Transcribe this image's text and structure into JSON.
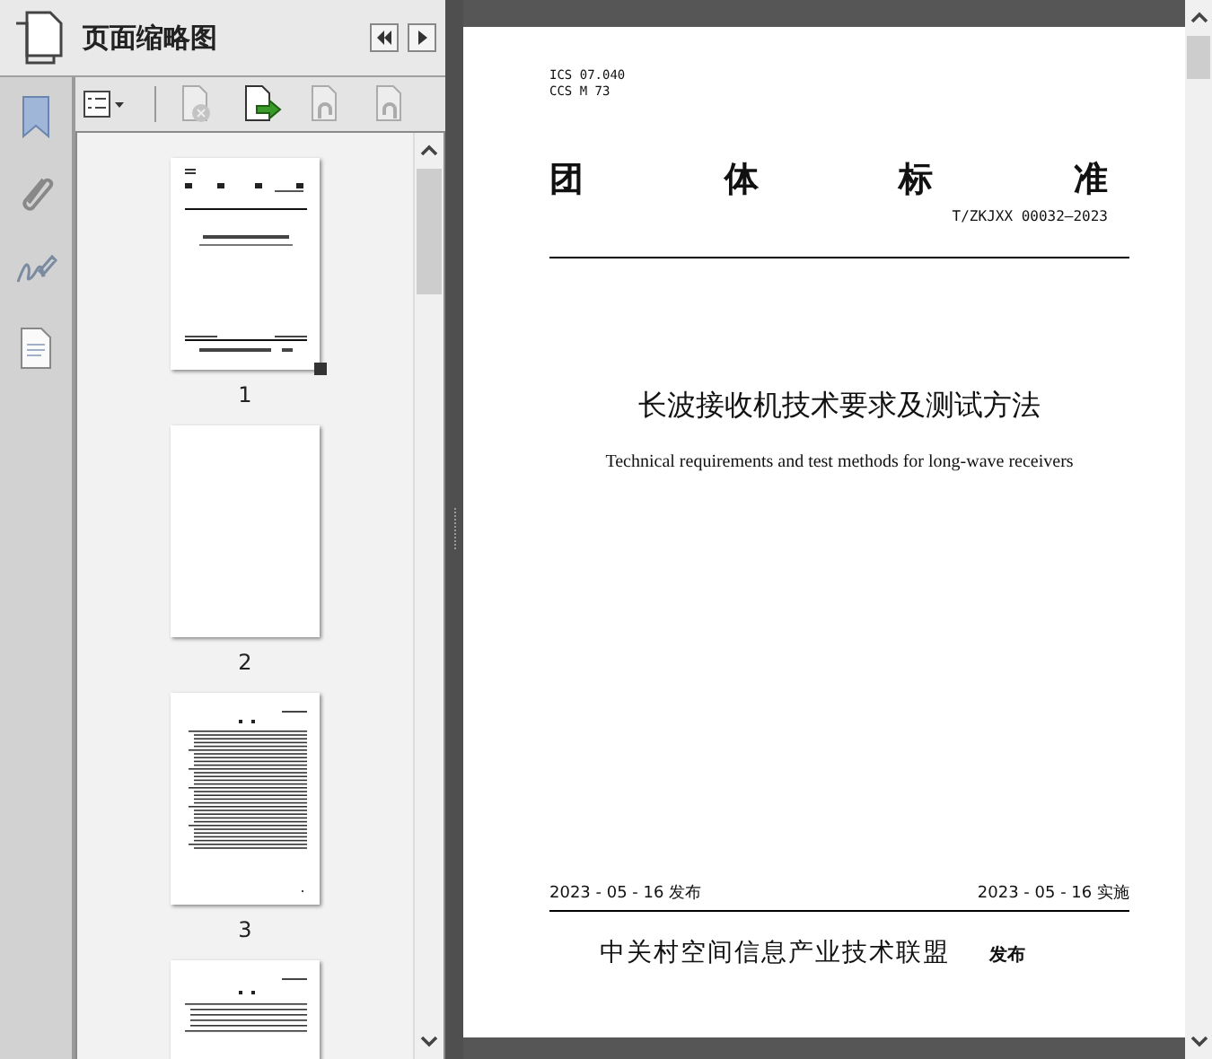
{
  "panel": {
    "title": "页面缩略图",
    "toolbar": [
      {
        "kind": "options",
        "disabled": false
      },
      {
        "kind": "delete",
        "disabled": true
      },
      {
        "kind": "rotate",
        "disabled": false
      },
      {
        "kind": "undo",
        "disabled": true
      },
      {
        "kind": "redo",
        "disabled": true
      }
    ],
    "thumbnails": [
      {
        "kind": "cover",
        "label": "1",
        "current": true
      },
      {
        "kind": "blank",
        "label": "2",
        "current": false
      },
      {
        "kind": "contents",
        "label": "3",
        "current": false
      },
      {
        "kind": "text",
        "current": false
      }
    ]
  },
  "document": {
    "codes": [
      "ICS 07.040",
      "CCS M 73"
    ],
    "heading": "团体标准",
    "number": "T/ZKJXX 00032—2023",
    "title": "长波接收机技术要求及测试方法",
    "subtitle": "Technical requirements and test methods for long-wave receivers",
    "issued": "2023 - 05 - 16 发布",
    "effective": "2023 - 05 - 16 实施",
    "publisher": "中关村空间信息产业技术联盟",
    "publisher_note": "发布"
  }
}
